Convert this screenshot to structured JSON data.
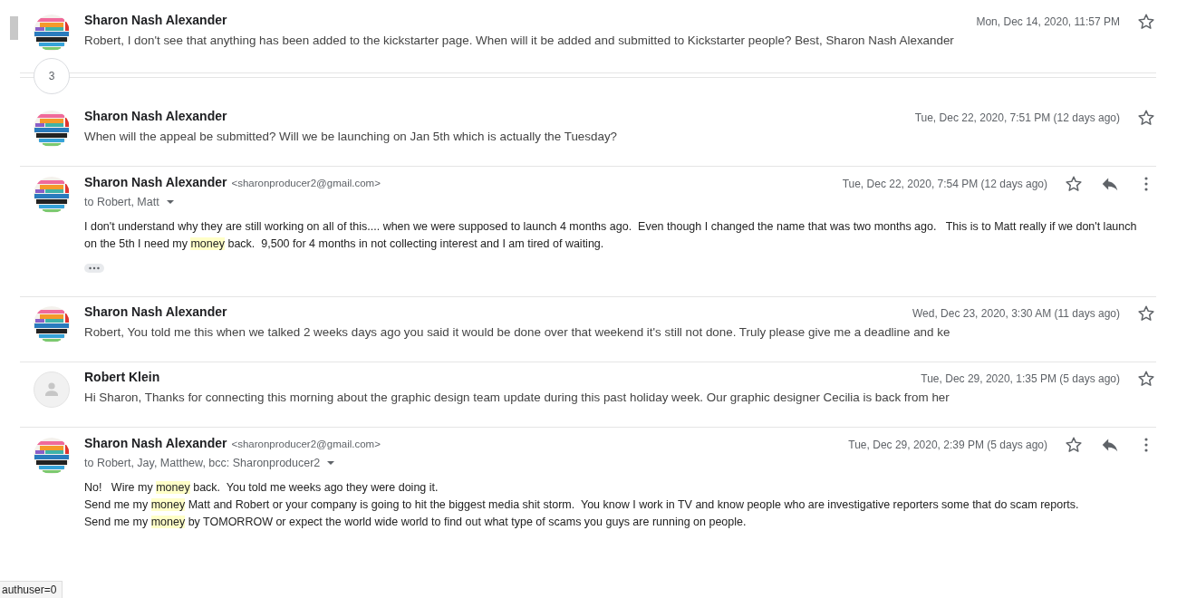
{
  "messages": [
    {
      "kind": "collapsed",
      "sender": "Sharon Nash Alexander",
      "snippet": "Robert, I don't see that anything has been added to the kickstarter page. When will it be added and submitted to Kickstarter people? Best, Sharon Nash Alexander",
      "date": "Mon, Dec 14, 2020, 11:57 PM",
      "starred": false
    },
    {
      "kind": "count",
      "count": "3"
    },
    {
      "kind": "collapsed",
      "sender": "Sharon Nash Alexander",
      "snippet": "When will the appeal be submitted? Will we be launching on Jan 5th which is actually the Tuesday?",
      "date": "Tue, Dec 22, 2020, 7:51 PM (12 days ago)",
      "starred": false
    },
    {
      "kind": "expanded",
      "sender": "Sharon Nash Alexander",
      "email": "<sharonproducer2@gmail.com>",
      "recipients": "to Robert, Matt",
      "date": "Tue, Dec 22, 2020, 7:54 PM (12 days ago)",
      "starred": false,
      "trimmed": true,
      "body": [
        [
          {
            "text": "I don't understand why they are still working on all of this.... when we were supposed to launch 4 months ago.  Even though I changed the name that was two months ago.   This is to Matt really if we don't launch on the 5th I need my ",
            "highlighted": false
          },
          {
            "text": "money",
            "highlighted": true
          },
          {
            "text": " back.  9,500 for 4 months in not collecting interest and I am tired of waiting.",
            "highlighted": false
          }
        ]
      ]
    },
    {
      "kind": "collapsed",
      "sender": "Sharon Nash Alexander",
      "snippet": "Robert, You told me this when we talked 2 weeks days ago you said it would be done over that weekend it's still not done. Truly please give me a deadline and ke",
      "date": "Wed, Dec 23, 2020, 3:30 AM (11 days ago)",
      "starred": false
    },
    {
      "kind": "collapsed",
      "avatar": {
        "kind": "person"
      },
      "sender": "Robert Klein",
      "snippet": "Hi Sharon, Thanks for connecting this morning about the graphic design team update during this past holiday week. Our graphic designer Cecilia is back from her",
      "date": "Tue, Dec 29, 2020, 1:35 PM (5 days ago)",
      "starred": false
    },
    {
      "kind": "expanded",
      "sender": "Sharon Nash Alexander",
      "email": "<sharonproducer2@gmail.com>",
      "recipients": "to Robert, Jay, Matthew, bcc: Sharonproducer2",
      "date": "Tue, Dec 29, 2020, 2:39 PM (5 days ago)",
      "starred": false,
      "body": [
        [
          {
            "text": "No!   Wire my ",
            "highlighted": false
          },
          {
            "text": "money",
            "highlighted": true
          },
          {
            "text": " back.  You told me weeks ago they were doing it.",
            "highlighted": false
          }
        ],
        [
          {
            "text": "Send me my ",
            "highlighted": false
          },
          {
            "text": "money",
            "highlighted": true
          },
          {
            "text": " Matt and Robert or your company is going to hit the biggest media shit storm.  You know I work in TV and know people who are investigative reporters some that do scam reports.",
            "highlighted": false
          }
        ],
        [
          {
            "text": "Send me my ",
            "highlighted": false
          },
          {
            "text": "money",
            "highlighted": true
          },
          {
            "text": " by TOMORROW or expect the world wide world to find out what type of scams you guys are running on people.",
            "highlighted": false
          }
        ]
      ]
    }
  ],
  "status_url": "authuser=0"
}
